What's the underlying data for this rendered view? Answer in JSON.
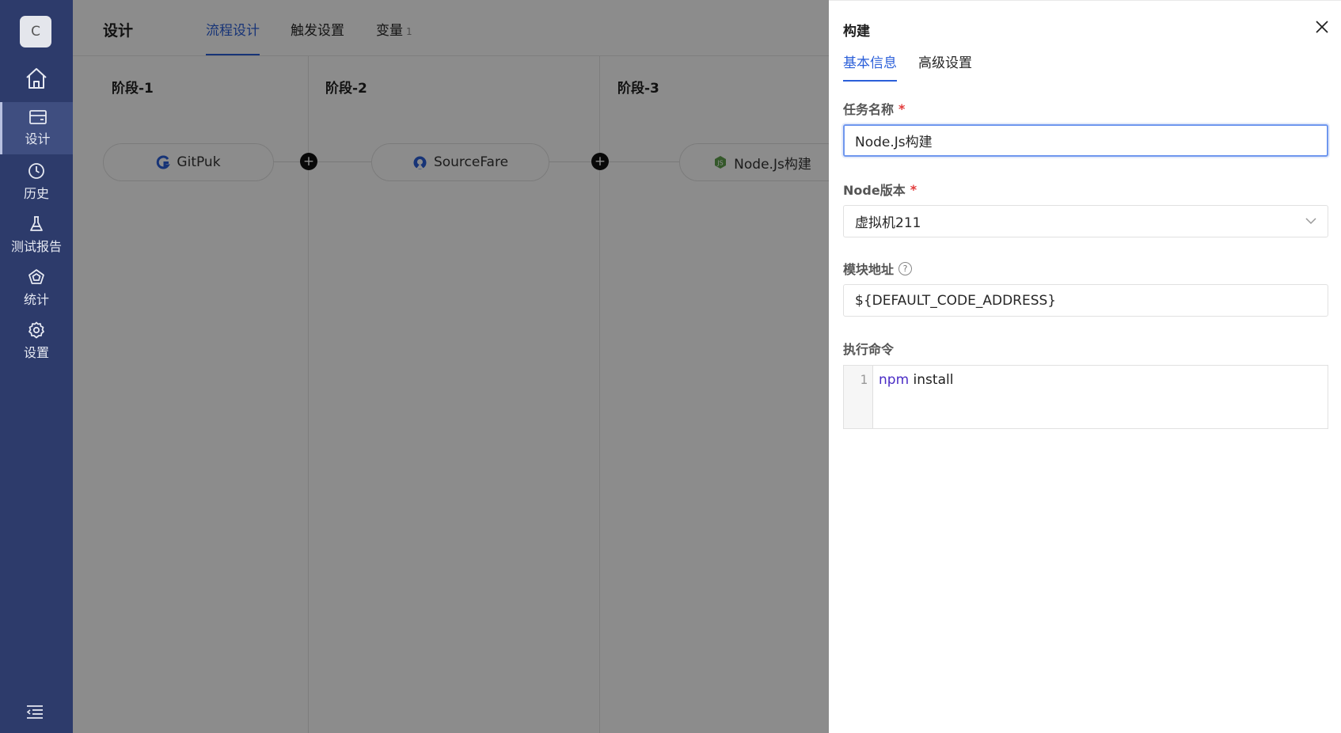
{
  "sidebar": {
    "avatar_letter": "C",
    "items": [
      {
        "label": "设计",
        "icon": "card-icon",
        "active": true
      },
      {
        "label": "历史",
        "icon": "clock-icon",
        "active": false
      },
      {
        "label": "测试报告",
        "icon": "flask-icon",
        "active": false
      },
      {
        "label": "统计",
        "icon": "pentagon-chart-icon",
        "active": false
      },
      {
        "label": "设置",
        "icon": "gear-icon",
        "active": false
      }
    ]
  },
  "header": {
    "title": "设计",
    "tabs": [
      {
        "label": "流程设计",
        "active": true
      },
      {
        "label": "触发设置",
        "active": false
      },
      {
        "label": "变量",
        "count": "1",
        "active": false
      }
    ]
  },
  "stages": [
    {
      "title": "阶段-1",
      "task": "GitPuk",
      "icon": "gitpuk-icon"
    },
    {
      "title": "阶段-2",
      "task": "SourceFare",
      "icon": "sourcefare-icon"
    },
    {
      "title": "阶段-3",
      "task": "Node.Js构建",
      "icon": "nodejs-icon"
    }
  ],
  "drawer": {
    "title": "构建",
    "tabs": [
      {
        "label": "基本信息",
        "active": true
      },
      {
        "label": "高级设置",
        "active": false
      }
    ],
    "fields": {
      "task_name": {
        "label": "任务名称",
        "required_mark": "*",
        "value": "Node.Js构建"
      },
      "node_version": {
        "label": "Node版本",
        "required_mark": "*",
        "value": "虚拟机211"
      },
      "module_address": {
        "label": "模块地址",
        "help": "?",
        "value": "${DEFAULT_CODE_ADDRESS}"
      },
      "command": {
        "label": "执行命令",
        "line_number": "1",
        "keyword": "npm",
        "rest": " install"
      }
    }
  },
  "colors": {
    "sidebar_bg": "#2d3b6b",
    "accent": "#2b5fd9",
    "required": "#e23a3a"
  }
}
